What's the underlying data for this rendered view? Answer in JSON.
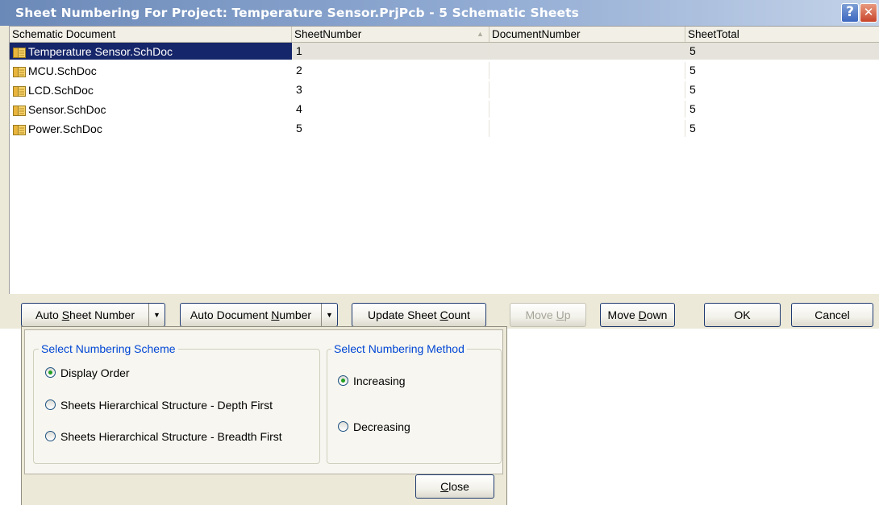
{
  "window": {
    "title": "Sheet Numbering For Project: Temperature Sensor.PrjPcb  - 5 Schematic Sheets",
    "help_glyph": "?",
    "close_glyph": "✕"
  },
  "grid": {
    "columns": [
      "Schematic Document",
      "SheetNumber",
      "DocumentNumber",
      "SheetTotal"
    ],
    "sort_indicator": "▲",
    "rows": [
      {
        "document": "Temperature Sensor.SchDoc",
        "sheet_number": "1",
        "document_number": "",
        "sheet_total": "5",
        "selected": true
      },
      {
        "document": "MCU.SchDoc",
        "sheet_number": "2",
        "document_number": "",
        "sheet_total": "5"
      },
      {
        "document": "LCD.SchDoc",
        "sheet_number": "3",
        "document_number": "",
        "sheet_total": "5"
      },
      {
        "document": "Sensor.SchDoc",
        "sheet_number": "4",
        "document_number": "",
        "sheet_total": "5"
      },
      {
        "document": "Power.SchDoc",
        "sheet_number": "5",
        "document_number": "",
        "sheet_total": "5"
      }
    ]
  },
  "buttons": {
    "auto_sheet_pre": "Auto ",
    "auto_sheet_key": "S",
    "auto_sheet_post": "heet Number",
    "auto_doc_pre": "Auto Document ",
    "auto_doc_key": "N",
    "auto_doc_post": "umber",
    "dropdown_glyph": "▼",
    "update_pre": "Update Sheet ",
    "update_key": "C",
    "update_post": "ount",
    "move_up_pre": "Move ",
    "move_up_key": "U",
    "move_up_post": "p",
    "move_down_pre": "Move ",
    "move_down_key": "D",
    "move_down_post": "own",
    "ok": "OK",
    "cancel": "Cancel"
  },
  "popup": {
    "scheme_title": "Select Numbering Scheme",
    "scheme_options": [
      {
        "label": "Display Order",
        "checked": true
      },
      {
        "label": "Sheets Hierarchical Structure - Depth First",
        "checked": false
      },
      {
        "label": "Sheets Hierarchical Structure - Breadth First",
        "checked": false
      }
    ],
    "method_title": "Select Numbering Method",
    "method_options": [
      {
        "label": "Increasing",
        "checked": true
      },
      {
        "label": "Decreasing",
        "checked": false
      }
    ],
    "close_key": "C",
    "close_post": "lose"
  },
  "colors": {
    "title_gradient_start": "#6b89b8",
    "selection": "#16266a",
    "group_title": "#0046d5",
    "radio_dot": "#21a121"
  }
}
